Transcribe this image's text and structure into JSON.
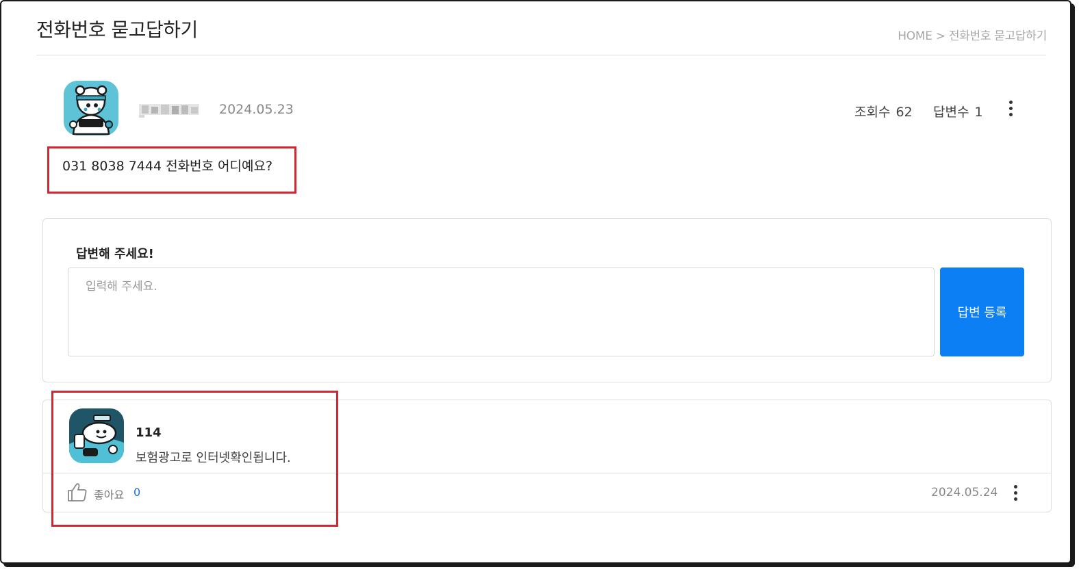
{
  "page": {
    "title": "전화번호 묻고답하기",
    "breadcrumb": "HOME > 전화번호 묻고답하기"
  },
  "post": {
    "date": "2024.05.23",
    "views_label": "조회수",
    "views_count": "62",
    "answers_label": "답변수",
    "answers_count": "1",
    "question": "031 8038 7444 전화번호 어디예요?"
  },
  "answer_form": {
    "label": "답변해 주세요!",
    "placeholder": "입력해 주세요.",
    "value": "",
    "submit_label": "답변 등록"
  },
  "replies": [
    {
      "author": "114",
      "text": "보험광고로 인터넷확인됩니다.",
      "like_label": "좋아요",
      "like_count": "0",
      "date": "2024.05.24"
    }
  ],
  "icons": {
    "post_avatar": "bear-mascot-avatar-icon",
    "reply_avatar": "mascot-avatar-icon",
    "more": "more-vertical-icon",
    "like": "thumbs-up-icon"
  },
  "colors": {
    "primary": "#0d7ff5",
    "highlight": "#d32630",
    "like_count": "#1a6fd0"
  }
}
